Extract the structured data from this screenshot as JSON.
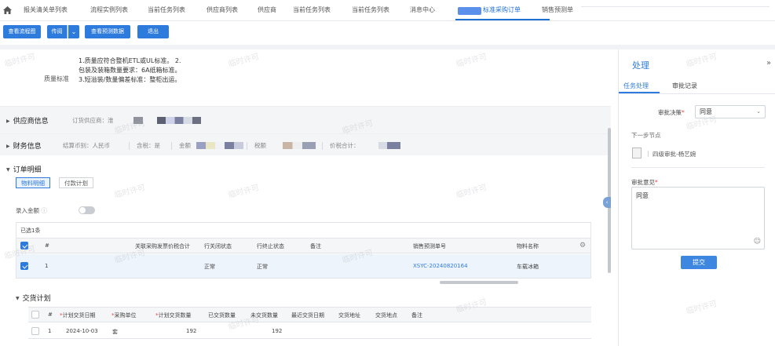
{
  "nav": {
    "tabs": [
      "报关清关单列表",
      "流程实例列表",
      "当前任务列表",
      "供应商列表",
      "供应商",
      "当前任务列表",
      "当前任务列表",
      "消息中心",
      "标准采购订单",
      "销售预测单"
    ]
  },
  "toolbar": {
    "btn1": "查看流程图",
    "btn2": "传阅",
    "btn3": "查看预测数据",
    "btn4": "退出"
  },
  "quality": {
    "label": "质量标准",
    "line1": "1.质量应符合整机ETL或UL标准。 2.",
    "line2": "包装及装箱数量要求：6A纸箱标准。",
    "line3": "3.短溢装/数量偏差标准：整柜出运。"
  },
  "supplier": {
    "title": "供应商信息",
    "field": "订货供应商：淮"
  },
  "finance": {
    "title": "财务信息",
    "currency": "结算币别：人民币",
    "tax_incl": "含税：是",
    "amount": "金额",
    "tax": "税额",
    "total": "价税合计："
  },
  "order": {
    "title": "订单明细",
    "subtab1": "物料明细",
    "subtab2": "付款计划",
    "amount_label": "录入金额",
    "amount_help": "ⓘ",
    "selected": "已选1条",
    "columns": [
      "#",
      "关联采购发票价税合计",
      "行关闭状态",
      "行终止状态",
      "备注",
      "销售预测单号",
      "物料名称"
    ],
    "row": {
      "no": "1",
      "close": "正常",
      "stop": "正常",
      "forecast_no": "XSYC-20240820164",
      "material": "车载冰箱"
    }
  },
  "delivery": {
    "title": "交货计划",
    "columns": [
      "#",
      "计划交货日期",
      "采购单位",
      "计划交货数量",
      "已交货数量",
      "未交货数量",
      "最近交货日期",
      "交货地址",
      "交货地点",
      "备注"
    ],
    "row": {
      "no": "1",
      "date": "2024-10-03",
      "unit": "套",
      "plan_qty": "192",
      "undelivered": "192"
    }
  },
  "panel": {
    "title": "处理",
    "expand": "»",
    "tab1": "任务处理",
    "tab2": "审批记录",
    "decision_label": "审批决策",
    "decision_value": "同意",
    "next_node": "下一步节点",
    "next_person": "四级审批-杨艺婉",
    "opinion_label": "审批意见",
    "opinion_value": "同意",
    "submit": "提交"
  },
  "watermark": "临时许可",
  "colors": {
    "accent": "#2d7bdc",
    "danger": "#e04848"
  }
}
